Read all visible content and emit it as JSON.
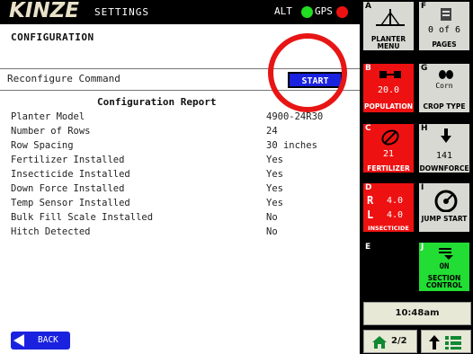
{
  "header": {
    "logo_text": "KINZE",
    "screen_title": "SETTINGS",
    "alt_label": "ALT",
    "gps_label": "GPS",
    "alt_status_color": "#22dd22",
    "gps_status_color": "#ee1111"
  },
  "main": {
    "title": "CONFIGURATION",
    "reconfigure_label": "Reconfigure Command",
    "start_label": "START",
    "report_heading": "Configuration Report",
    "report_rows": [
      {
        "label": "Planter Model",
        "value": "4900-24R30"
      },
      {
        "label": "Number of Rows",
        "value": "24"
      },
      {
        "label": "Row Spacing",
        "value": "30 inches"
      },
      {
        "label": "Fertilizer Installed",
        "value": "Yes"
      },
      {
        "label": "Insecticide Installed",
        "value": "Yes"
      },
      {
        "label": "Down Force Installed",
        "value": "Yes"
      },
      {
        "label": "Temp Sensor Installed",
        "value": "Yes"
      },
      {
        "label": "Bulk Fill Scale Installed",
        "value": "No"
      },
      {
        "label": "Hitch Detected",
        "value": "No"
      }
    ],
    "back_label": "BACK"
  },
  "side": {
    "tileA": {
      "letter": "A",
      "caption": "PLANTER MENU"
    },
    "tileF": {
      "letter": "F",
      "value": "0 of 6",
      "caption": "PAGES"
    },
    "tileB": {
      "letter": "B",
      "value": "20.0",
      "caption": "POPULATION"
    },
    "tileG": {
      "letter": "G",
      "value": "Corn",
      "caption": "CROP TYPE"
    },
    "tileC": {
      "letter": "C",
      "value": "21",
      "caption": "FERTILIZER"
    },
    "tileH": {
      "letter": "H",
      "value": "141",
      "caption": "DOWNFORCE"
    },
    "tileD": {
      "letter": "D",
      "r_label": "R",
      "r_value": "4.0",
      "l_label": "L",
      "l_value": "4.0",
      "caption": "INSECTICIDE"
    },
    "tileI": {
      "letter": "I",
      "caption": "JUMP START"
    },
    "tileE": {
      "letter": "E"
    },
    "tileJ": {
      "letter": "J",
      "value": "ON",
      "caption": "SECTION CONTROL"
    },
    "time": "10:48am",
    "page": "2/2"
  }
}
